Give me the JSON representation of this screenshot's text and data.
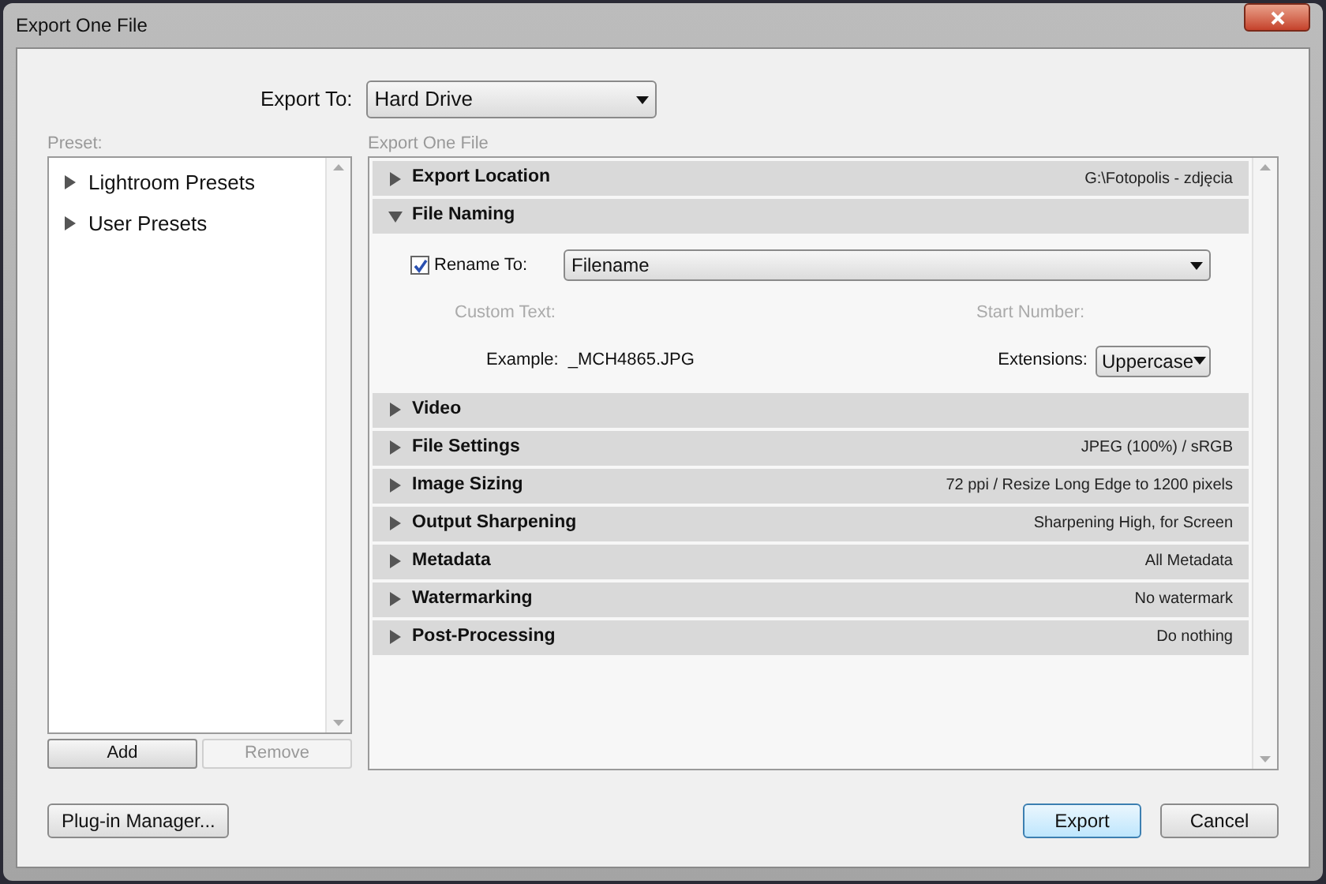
{
  "window": {
    "title": "Export One File"
  },
  "export_to": {
    "label": "Export To:",
    "value": "Hard Drive"
  },
  "preset": {
    "label": "Preset:",
    "items": [
      {
        "label": "Lightroom Presets",
        "expanded": false
      },
      {
        "label": "User Presets",
        "expanded": false
      }
    ],
    "buttons": [
      {
        "label": "Add",
        "disabled": false
      },
      {
        "label": "Remove",
        "disabled": true
      }
    ]
  },
  "panel": {
    "label": "Export One File",
    "sections": [
      {
        "title": "Export Location",
        "summary": "G:\\Fotopolis - zdjęcia",
        "expanded": false
      },
      {
        "title": "File Naming",
        "expanded": true,
        "rename": {
          "label": "Rename To:",
          "checked": true,
          "value": "Filename"
        },
        "custom_text": "Custom Text:",
        "start_number": "Start Number:",
        "example_label": "Example:",
        "example": "_MCH4865.JPG",
        "extensions": {
          "label": "Extensions:",
          "value": "Uppercase"
        }
      },
      {
        "title": "Video",
        "expanded": false
      },
      {
        "title": "File Settings",
        "summary": "JPEG (100%) / sRGB",
        "expanded": false
      },
      {
        "title": "Image Sizing",
        "summary": "72 ppi / Resize Long Edge to 1200 pixels",
        "expanded": false
      },
      {
        "title": "Output Sharpening",
        "summary": "Sharpening High, for Screen",
        "expanded": false
      },
      {
        "title": "Metadata",
        "summary": "All Metadata",
        "expanded": false
      },
      {
        "title": "Watermarking",
        "summary": "No watermark",
        "expanded": false
      },
      {
        "title": "Post-Processing",
        "summary": "Do nothing",
        "expanded": false
      }
    ]
  },
  "footer": {
    "plugin_button": "Plug-in Manager...",
    "export_button": "Export",
    "cancel_button": "Cancel"
  }
}
